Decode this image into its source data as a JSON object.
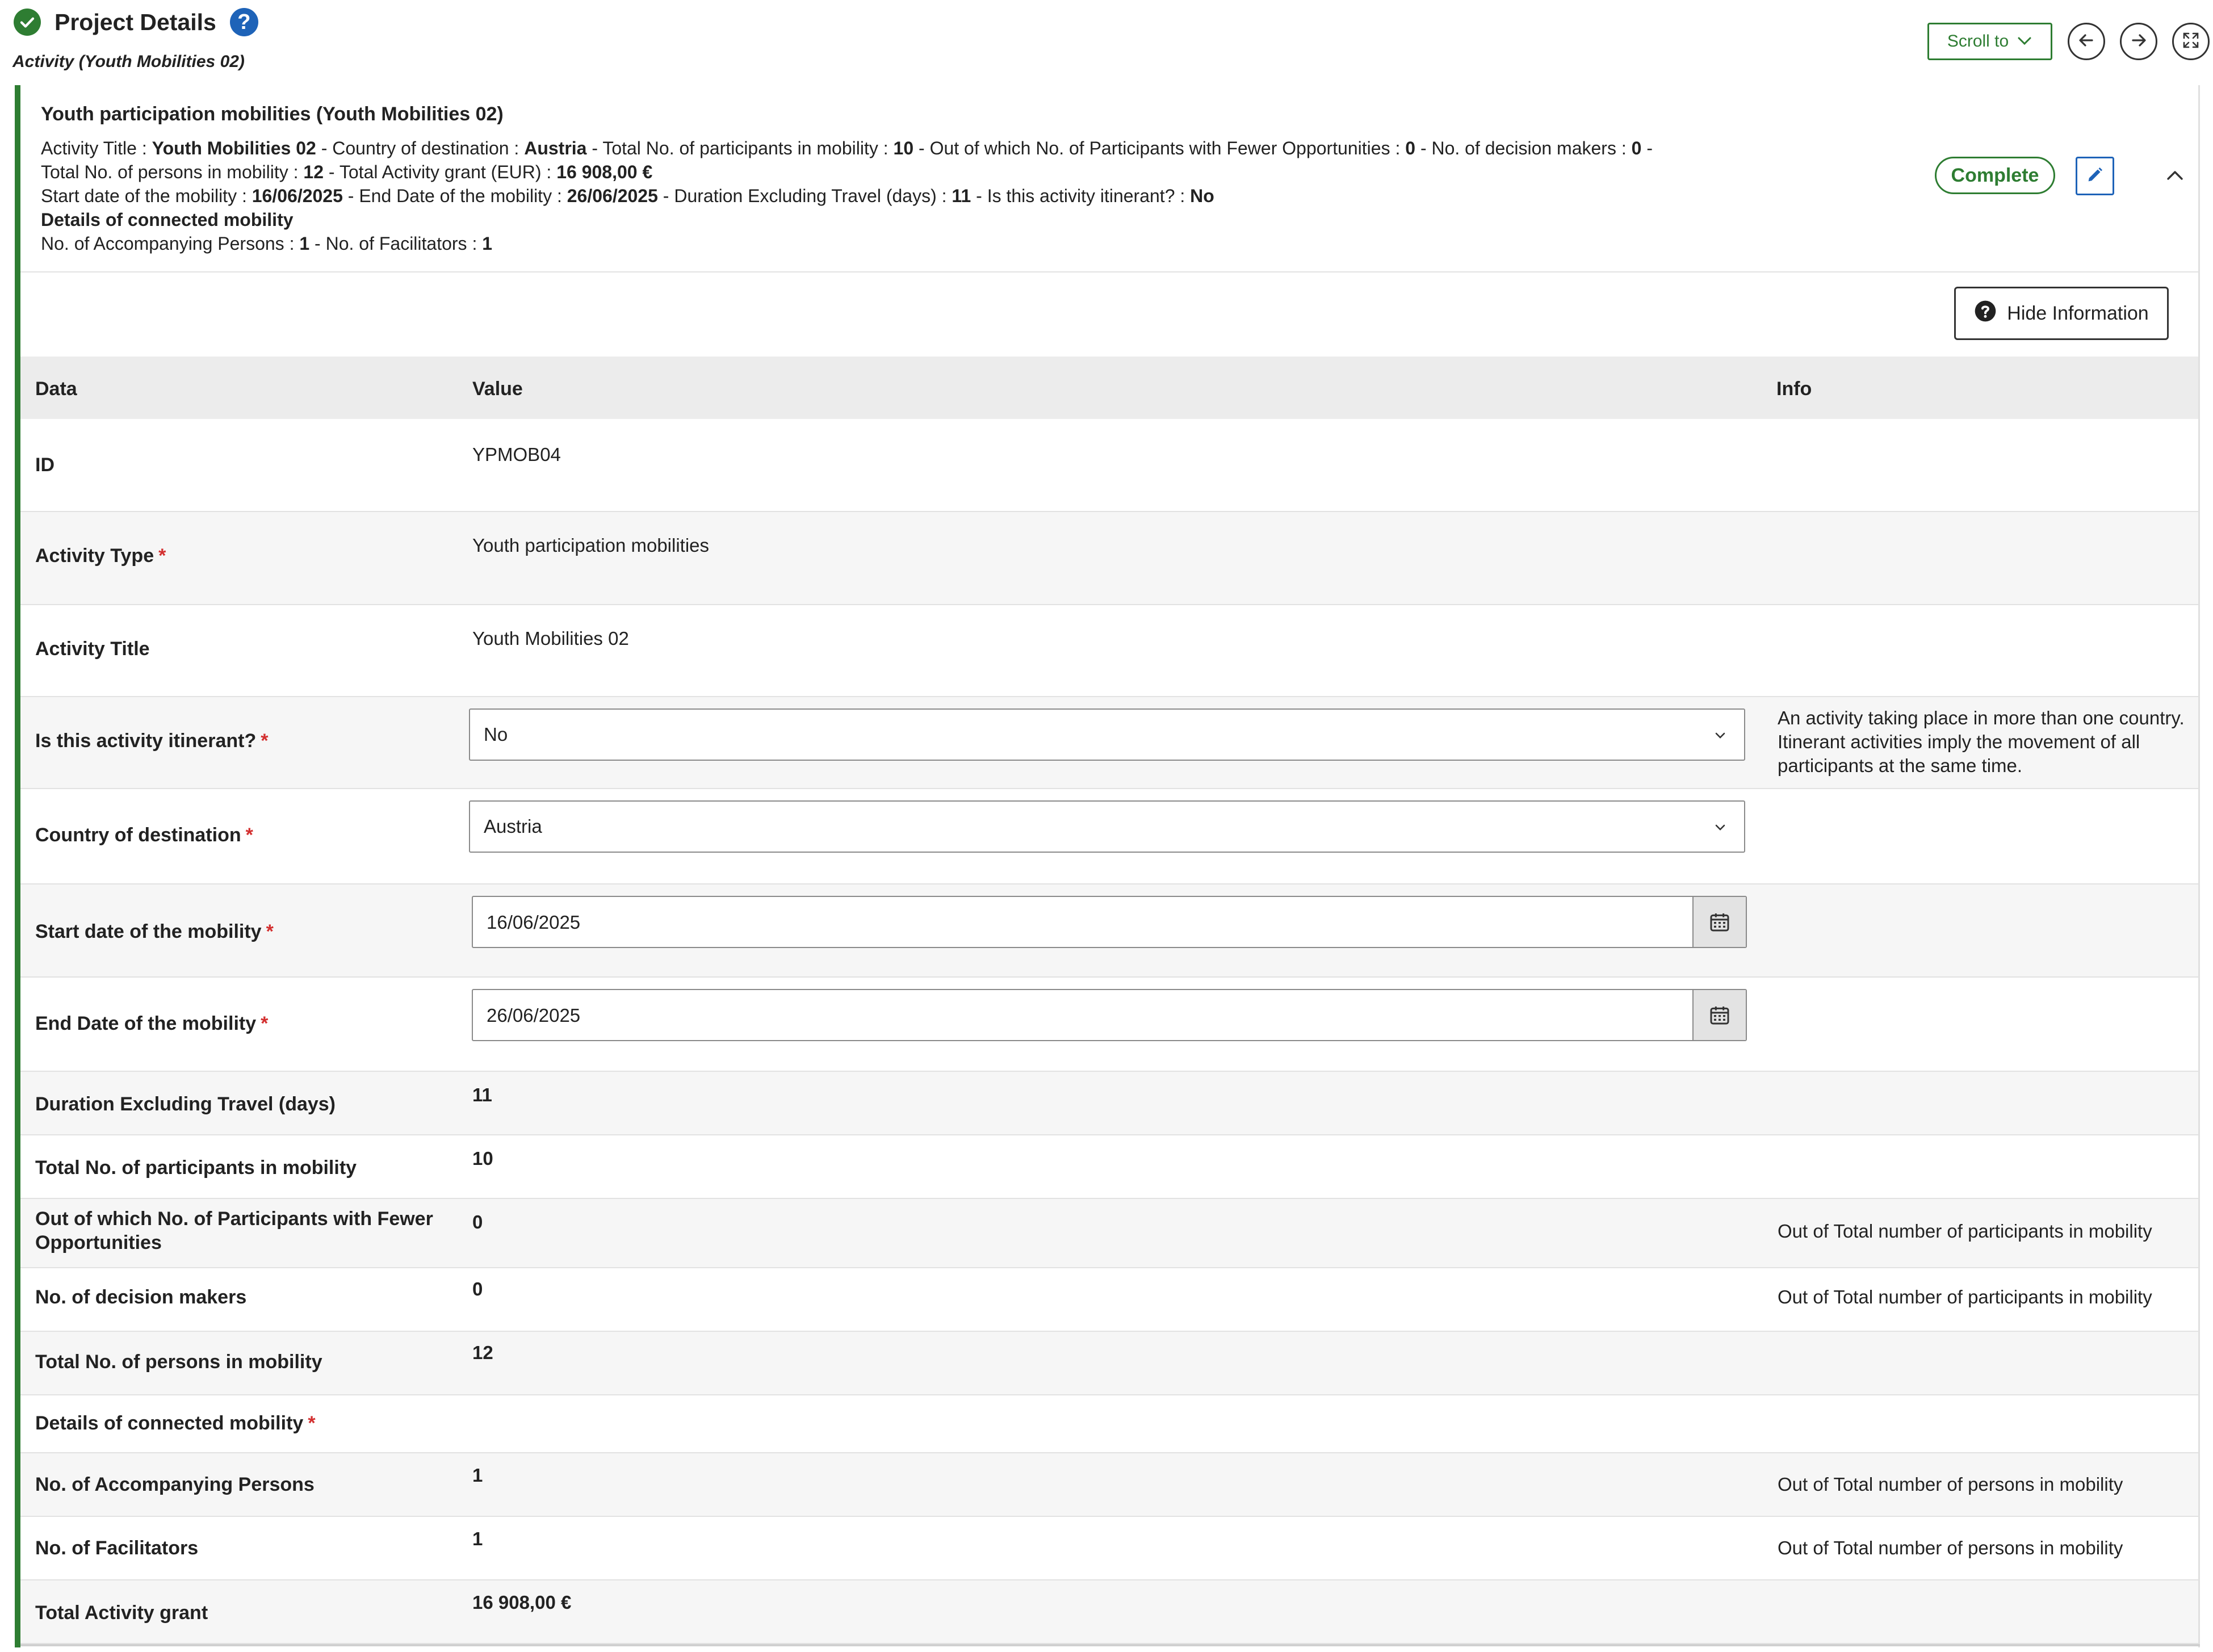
{
  "header": {
    "title": "Project Details",
    "help_glyph": "?",
    "subtitle": "Activity (Youth Mobilities 02)",
    "scroll_to_label": "Scroll to",
    "icons": [
      "check-circle-icon",
      "help-icon",
      "chevron-down-icon",
      "arrow-left-icon",
      "arrow-right-icon",
      "fullscreen-icon"
    ]
  },
  "summary": {
    "title": "Youth participation mobilities (Youth Mobilities 02)",
    "line1": [
      {
        "k": "Activity Title : ",
        "v": "Youth Mobilities 02"
      },
      {
        "k": " - Country of destination : ",
        "v": "Austria"
      },
      {
        "k": " - Total No. of participants in mobility : ",
        "v": "10"
      },
      {
        "k": " - Out of which No. of Participants with Fewer Opportunities : ",
        "v": "0"
      },
      {
        "k": " - No. of decision makers : ",
        "v": "0"
      },
      {
        "k": " -",
        "v": ""
      }
    ],
    "line2": [
      {
        "k": "Total No. of persons in mobility : ",
        "v": "12"
      },
      {
        "k": " - Total Activity grant (EUR) : ",
        "v": "16 908,00 €"
      }
    ],
    "line3": [
      {
        "k": "Start date of the mobility : ",
        "v": "16/06/2025"
      },
      {
        "k": " - End Date of the mobility : ",
        "v": "26/06/2025"
      },
      {
        "k": " - Duration Excluding Travel (days) : ",
        "v": "11"
      },
      {
        "k": " - Is this activity itinerant? : ",
        "v": "No"
      }
    ],
    "line4_bold": "Details of connected mobility",
    "line5": [
      {
        "k": "No. of Accompanying Persons : ",
        "v": "1"
      },
      {
        "k": " - No. of Facilitators : ",
        "v": "1"
      }
    ],
    "status": "Complete"
  },
  "hide_info_label": "Hide Information",
  "columns": {
    "data": "Data",
    "value": "Value",
    "info": "Info"
  },
  "rows": {
    "id": {
      "label": "ID",
      "value": "YPMOB04"
    },
    "activity_type": {
      "label": "Activity Type",
      "required": "*",
      "value": "Youth participation mobilities"
    },
    "activity_title": {
      "label": "Activity Title",
      "value": "Youth Mobilities 02"
    },
    "itinerant": {
      "label": "Is this activity itinerant?",
      "required": "*",
      "value": "No",
      "info": "An activity taking place in more than one country. Itinerant activities imply the movement of all participants at the same time."
    },
    "country": {
      "label": "Country of destination",
      "required": "*",
      "value": "Austria"
    },
    "start_date": {
      "label": "Start date of the mobility",
      "required": "*",
      "value": "16/06/2025"
    },
    "end_date": {
      "label": "End Date of the mobility",
      "required": "*",
      "value": "26/06/2025"
    },
    "duration": {
      "label": "Duration Excluding Travel (days)",
      "value": "11"
    },
    "participants": {
      "label": "Total No. of participants in mobility",
      "value": "10"
    },
    "fewer_opps": {
      "label": "Out of which No. of Participants with Fewer Opportunities",
      "value": "0",
      "info": "Out of Total number of participants in mobility"
    },
    "decision_makers": {
      "label": "No. of decision makers",
      "value": "0",
      "info": "Out of Total number of participants in mobility"
    },
    "persons": {
      "label": "Total No. of persons in mobility",
      "value": "12"
    },
    "connected": {
      "label": "Details of connected mobility",
      "required": "*"
    },
    "accompanying": {
      "label": "No. of Accompanying Persons",
      "value": "1",
      "info": "Out of Total number of persons in mobility"
    },
    "facilitators": {
      "label": "No. of Facilitators",
      "value": "1",
      "info": "Out of Total number of persons in mobility"
    },
    "grant": {
      "label": "Total Activity grant",
      "value": "16 908,00 €"
    }
  },
  "colors": {
    "accent_green": "#2e7d32",
    "link_blue": "#1e63b8",
    "required_red": "#d32f2f"
  }
}
